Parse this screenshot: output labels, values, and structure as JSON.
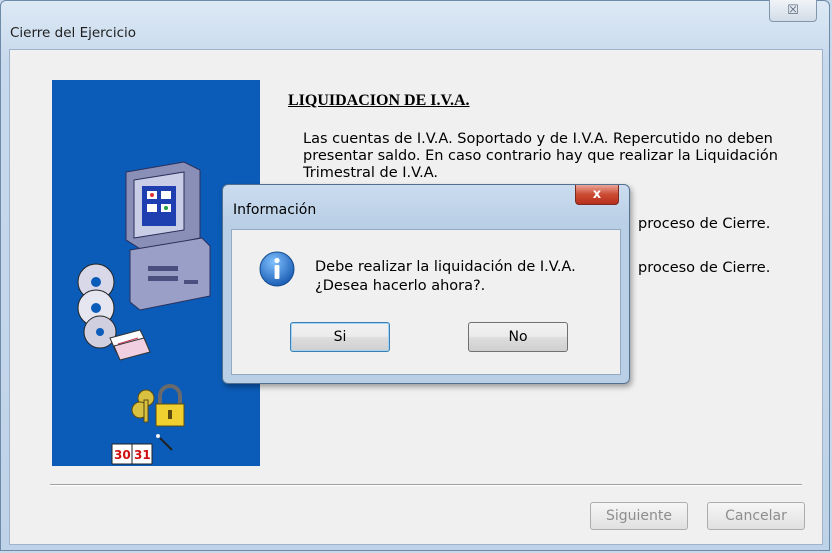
{
  "window": {
    "title": "Cierre del Ejercicio",
    "close_glyph": "☒"
  },
  "wizard": {
    "heading": "LIQUIDACION DE I.V.A.",
    "paragraph": "Las cuentas de I.V.A. Soportado y de I.V.A. Repercutido no deben presentar saldo. En caso contrario hay que realizar la Liquidación Trimestral de I.V.A.",
    "line_cierre_1": "proceso de Cierre.",
    "line_cierre_2": "proceso de Cierre.",
    "next_button": "Siguiente",
    "cancel_button": "Cancelar",
    "calendar_text": "30 31"
  },
  "dialog": {
    "title": "Información",
    "close_glyph": "x",
    "icon": "info-icon",
    "message_line1": "Debe realizar la liquidación de I.V.A.",
    "message_line2": "¿Desea hacerlo ahora?.",
    "yes_button": "Si",
    "no_button": "No"
  },
  "colors": {
    "side_panel": "#0b5cb8",
    "close_red": "#cc4a32",
    "info_blue": "#1c5fb5"
  }
}
